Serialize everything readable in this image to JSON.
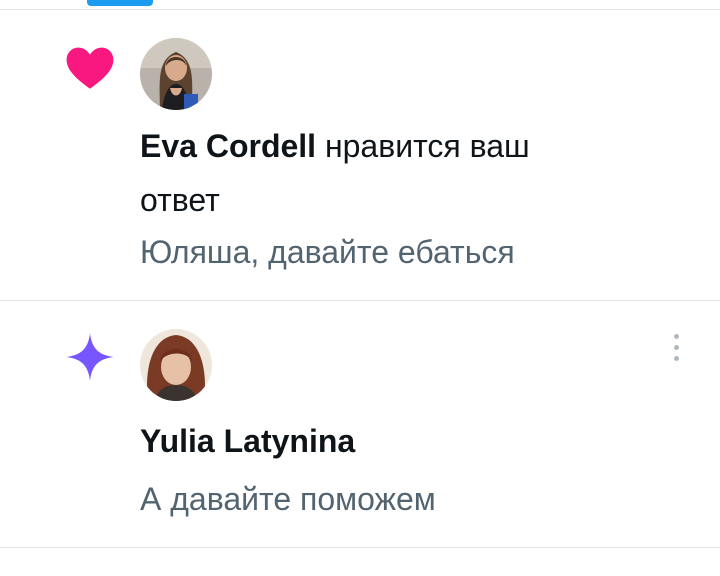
{
  "accent_color": "#1d9bf0",
  "notifications": [
    {
      "type_icon": "heart-icon",
      "icon_color": "#f91880",
      "user_name": "Eva Cordell",
      "action_text": " нравится ваш",
      "action_text_cont": "ответ",
      "preview": "Юляша, давайте ебаться"
    },
    {
      "type_icon": "sparkle-icon",
      "icon_color": "#7856ff",
      "user_name": "Yulia Latynina",
      "preview": "А давайте поможем",
      "menu_icon": "more-vertical-icon"
    }
  ]
}
